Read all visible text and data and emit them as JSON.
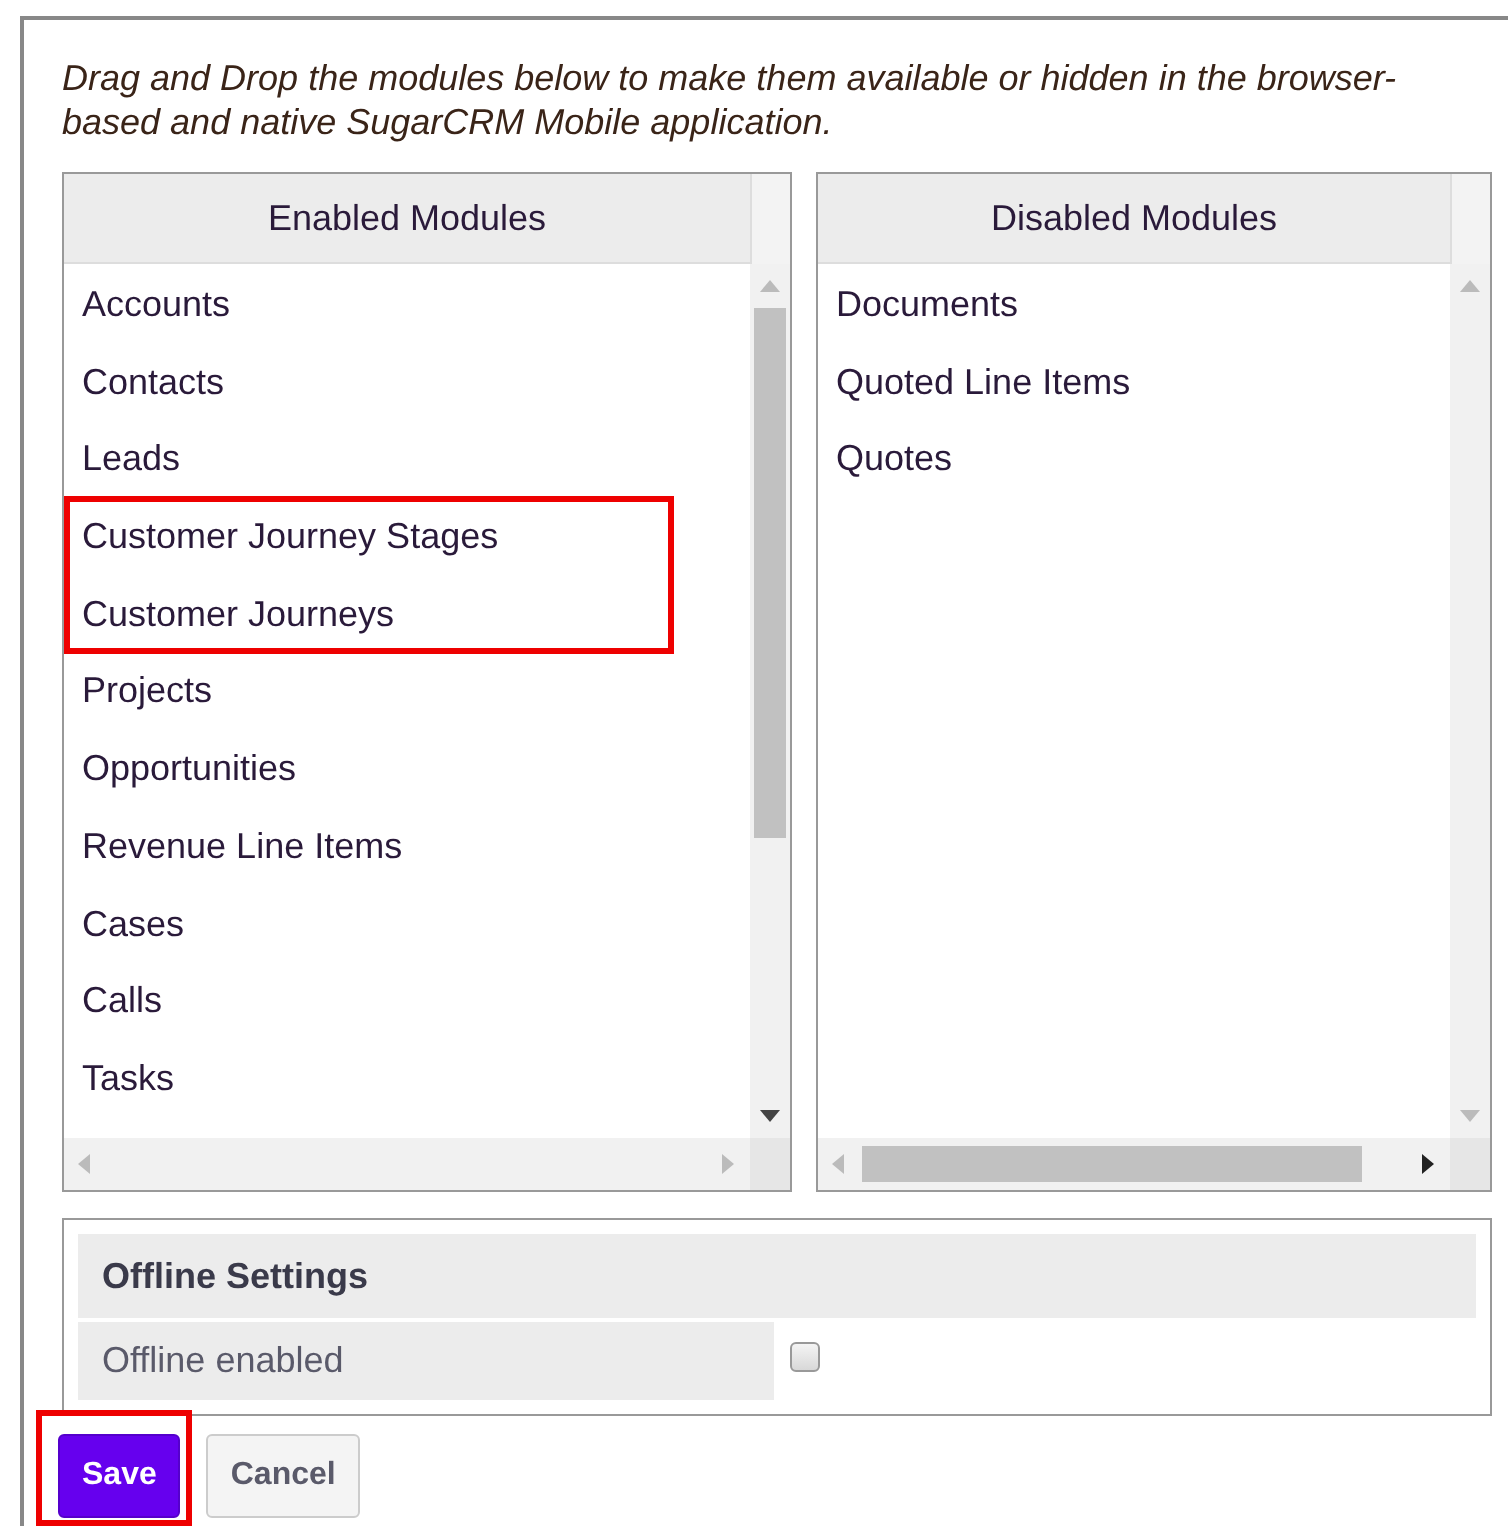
{
  "instructions": "Drag and Drop the modules below to make them available or hidden in the browser-based and native SugarCRM Mobile application.",
  "lists": [
    {
      "title": "Enabled Modules",
      "items": [
        {
          "label": "Accounts",
          "highlighted": false
        },
        {
          "label": "Contacts",
          "highlighted": false
        },
        {
          "label": "Leads",
          "highlighted": false
        },
        {
          "label": "Customer Journey Stages",
          "highlighted": true
        },
        {
          "label": "Customer Journeys",
          "highlighted": true
        },
        {
          "label": "Projects",
          "highlighted": false
        },
        {
          "label": "Opportunities",
          "highlighted": false
        },
        {
          "label": "Revenue Line Items",
          "highlighted": false
        },
        {
          "label": "Cases",
          "highlighted": false
        },
        {
          "label": "Calls",
          "highlighted": false
        },
        {
          "label": "Tasks",
          "highlighted": false
        }
      ]
    },
    {
      "title": "Disabled Modules",
      "items": [
        {
          "label": "Documents",
          "highlighted": false
        },
        {
          "label": "Quoted Line Items",
          "highlighted": false
        },
        {
          "label": "Quotes",
          "highlighted": false
        }
      ]
    }
  ],
  "offline_settings": {
    "title": "Offline Settings",
    "label": "Offline enabled",
    "checked": false
  },
  "buttons": [
    {
      "label": "Save",
      "kind": "primary",
      "highlighted": true
    },
    {
      "label": "Cancel",
      "kind": "secondary",
      "highlighted": false
    }
  ]
}
